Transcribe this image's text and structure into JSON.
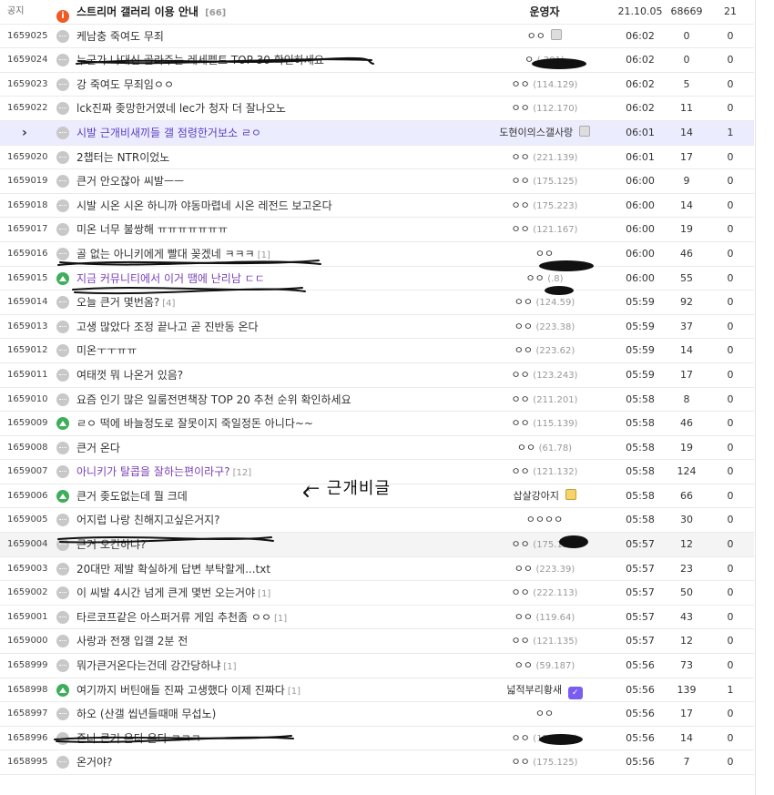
{
  "notice": {
    "no": "공지",
    "title": "스트리머 갤러리 이용 안내",
    "comments": "[66]",
    "writer": "운영자",
    "date": "21.10.05",
    "views": "68669",
    "recommend": "21"
  },
  "current_marker": "›",
  "annotation": "← 근개비글",
  "posts": [
    {
      "no": "1659025",
      "icon": "speech",
      "title": "케남충 죽여도 무죄",
      "comments": "",
      "writer": "ㅇㅇ",
      "ip": "",
      "date": "06:02",
      "views": "0",
      "recommend": "0",
      "badge": "gray"
    },
    {
      "no": "1659024",
      "icon": "speech",
      "title": "누군가 나대신 골라주는 레세펠트 TOP 30 확인하세요",
      "comments": "",
      "writer": "ㅇ",
      "ip": "(.201)",
      "date": "06:02",
      "views": "0",
      "recommend": "0"
    },
    {
      "no": "1659023",
      "icon": "speech",
      "title": "강 죽여도 무죄임ㅇㅇ",
      "comments": "",
      "writer": "ㅇㅇ",
      "ip": "(114.129)",
      "date": "06:02",
      "views": "5",
      "recommend": "0"
    },
    {
      "no": "1659022",
      "icon": "speech",
      "title": "lck진짜 좆망한거였네 lec가 청자 더 잘나오노",
      "comments": "",
      "writer": "ㅇㅇ",
      "ip": "(112.170)",
      "date": "06:02",
      "views": "11",
      "recommend": "0"
    },
    {
      "no": "",
      "icon": "speech",
      "title": "시발 근개비새끼들 갤 점령한거보소 ㄹㅇ",
      "comments": "",
      "writer": "도현이의스갤사랑",
      "ip": "",
      "date": "06:01",
      "views": "14",
      "recommend": "1",
      "badge": "gray",
      "current": true
    },
    {
      "no": "1659020",
      "icon": "speech",
      "title": "2챕터는 NTR이었노",
      "comments": "",
      "writer": "ㅇㅇ",
      "ip": "(221.139)",
      "date": "06:01",
      "views": "17",
      "recommend": "0"
    },
    {
      "no": "1659019",
      "icon": "speech",
      "title": "큰거 안오잖아 씨발ㅡㅡ",
      "comments": "",
      "writer": "ㅇㅇ",
      "ip": "(175.125)",
      "date": "06:00",
      "views": "9",
      "recommend": "0"
    },
    {
      "no": "1659018",
      "icon": "speech",
      "title": "시발 시온 시온 하니까 야동마렵네 시온 레전드 보고온다",
      "comments": "",
      "writer": "ㅇㅇ",
      "ip": "(175.223)",
      "date": "06:00",
      "views": "14",
      "recommend": "0"
    },
    {
      "no": "1659017",
      "icon": "speech",
      "title": "미온 너무 불쌍해 ㅠㅠㅠㅠㅠㅠㅠ",
      "comments": "",
      "writer": "ㅇㅇ",
      "ip": "(121.167)",
      "date": "06:00",
      "views": "19",
      "recommend": "0"
    },
    {
      "no": "1659016",
      "icon": "speech",
      "title": "골 없는 아니키에게 빨대 꽂겠네 ㅋㅋㅋ",
      "comments": "[1]",
      "writer": "ㅇㅇ",
      "ip": "",
      "date": "06:00",
      "views": "46",
      "recommend": "0"
    },
    {
      "no": "1659015",
      "icon": "image",
      "title": "지금 커뮤니티에서 이거 땜에 난리남 ㄷㄷ",
      "comments": "",
      "writer": "ㅇㅇ",
      "ip": "(.8)",
      "date": "06:00",
      "views": "55",
      "recommend": "0",
      "purple": true
    },
    {
      "no": "1659014",
      "icon": "speech",
      "title": "오늘 큰거 몇번옴?",
      "comments": "[4]",
      "writer": "ㅇㅇ",
      "ip": "(124.59)",
      "date": "05:59",
      "views": "92",
      "recommend": "0"
    },
    {
      "no": "1659013",
      "icon": "speech",
      "title": "고생 많았다 조정 끝나고 곧 진반동 온다",
      "comments": "",
      "writer": "ㅇㅇ",
      "ip": "(223.38)",
      "date": "05:59",
      "views": "37",
      "recommend": "0"
    },
    {
      "no": "1659012",
      "icon": "speech",
      "title": "미온ㅜㅜㅠㅠ",
      "comments": "",
      "writer": "ㅇㅇ",
      "ip": "(223.62)",
      "date": "05:59",
      "views": "14",
      "recommend": "0"
    },
    {
      "no": "1659011",
      "icon": "speech",
      "title": "여태껏 뭐 나온거 있음?",
      "comments": "",
      "writer": "ㅇㅇ",
      "ip": "(123.243)",
      "date": "05:59",
      "views": "17",
      "recommend": "0"
    },
    {
      "no": "1659010",
      "icon": "speech",
      "title": "요즘 인기 많은 일룸전면책장 TOP 20 추천 순위 확인하세요",
      "comments": "",
      "writer": "ㅇㅇ",
      "ip": "(211.201)",
      "date": "05:58",
      "views": "8",
      "recommend": "0"
    },
    {
      "no": "1659009",
      "icon": "image",
      "title": "ㄹㅇ 떡에 바늘정도로 잘못이지 죽일정돈 아니다~~",
      "comments": "",
      "writer": "ㅇㅇ",
      "ip": "(115.139)",
      "date": "05:58",
      "views": "46",
      "recommend": "0"
    },
    {
      "no": "1659008",
      "icon": "speech",
      "title": "큰거 온다",
      "comments": "",
      "writer": "ㅇㅇ",
      "ip": "(61.78)",
      "date": "05:58",
      "views": "19",
      "recommend": "0"
    },
    {
      "no": "1659007",
      "icon": "speech",
      "title": "아니키가 탈콥을 잘하는편이라구?",
      "comments": "[12]",
      "writer": "ㅇㅇ",
      "ip": "(121.132)",
      "date": "05:58",
      "views": "124",
      "recommend": "0",
      "purple": true
    },
    {
      "no": "1659006",
      "icon": "image",
      "title": "큰거 좆도없는데 뭘 크데",
      "comments": "",
      "writer": "삽살강아지",
      "ip": "",
      "date": "05:58",
      "views": "66",
      "recommend": "0",
      "badge": "gold"
    },
    {
      "no": "1659005",
      "icon": "speech",
      "title": "어지럽 나랑 친해지고싶은거지?",
      "comments": "",
      "writer": "ㅇㅇㅇㅇ",
      "ip": "",
      "date": "05:58",
      "views": "30",
      "recommend": "0"
    },
    {
      "no": "1659004",
      "icon": "speech",
      "title": "큰거 오긴하냐?",
      "comments": "",
      "writer": "ㅇㅇ",
      "ip": "(175.125)",
      "date": "05:57",
      "views": "12",
      "recommend": "0",
      "hl": true
    },
    {
      "no": "1659003",
      "icon": "speech",
      "title": "20대만 제발 확실하게 답변 부탁할게...txt",
      "comments": "",
      "writer": "ㅇㅇ",
      "ip": "(223.39)",
      "date": "05:57",
      "views": "23",
      "recommend": "0"
    },
    {
      "no": "1659002",
      "icon": "speech",
      "title": "이 씨발 4시간 넘게 큰게 몇번 오는거야",
      "comments": "[1]",
      "writer": "ㅇㅇ",
      "ip": "(222.113)",
      "date": "05:57",
      "views": "50",
      "recommend": "0"
    },
    {
      "no": "1659001",
      "icon": "speech",
      "title": "타르코프같은 아스퍼거류 게임 추천좀 ㅇㅇ",
      "comments": "[1]",
      "writer": "ㅇㅇ",
      "ip": "(119.64)",
      "date": "05:57",
      "views": "43",
      "recommend": "0"
    },
    {
      "no": "1659000",
      "icon": "speech",
      "title": "사랑과 전쟁 입갤 2분 전",
      "comments": "",
      "writer": "ㅇㅇ",
      "ip": "(121.135)",
      "date": "05:57",
      "views": "12",
      "recommend": "0"
    },
    {
      "no": "1658999",
      "icon": "speech",
      "title": "뭐가큰거온다는건데 강간당하냐",
      "comments": "[1]",
      "writer": "ㅇㅇ",
      "ip": "(59.187)",
      "date": "05:56",
      "views": "73",
      "recommend": "0"
    },
    {
      "no": "1658998",
      "icon": "image",
      "title": "여기까지 버틴애들 진짜 고생했다 이제 진짜다",
      "comments": "[1]",
      "writer": "넓적부리황새",
      "ip": "",
      "date": "05:56",
      "views": "139",
      "recommend": "1",
      "badge": "purple"
    },
    {
      "no": "1658997",
      "icon": "speech",
      "title": "하오 (산갤 씹년들때매 무섭노)",
      "comments": "",
      "writer": "ㅇㅇ",
      "ip": "",
      "date": "05:56",
      "views": "17",
      "recommend": "0"
    },
    {
      "no": "1658996",
      "icon": "speech",
      "title": "존나 큰거 온다 온다 ㅋㅋㅋ",
      "comments": "",
      "writer": "ㅇㅇ",
      "ip": "(121.167)",
      "date": "05:56",
      "views": "14",
      "recommend": "0"
    },
    {
      "no": "1658995",
      "icon": "speech",
      "title": "온거야?",
      "comments": "",
      "writer": "ㅇㅇ",
      "ip": "(175.125)",
      "date": "05:56",
      "views": "7",
      "recommend": "0"
    }
  ]
}
